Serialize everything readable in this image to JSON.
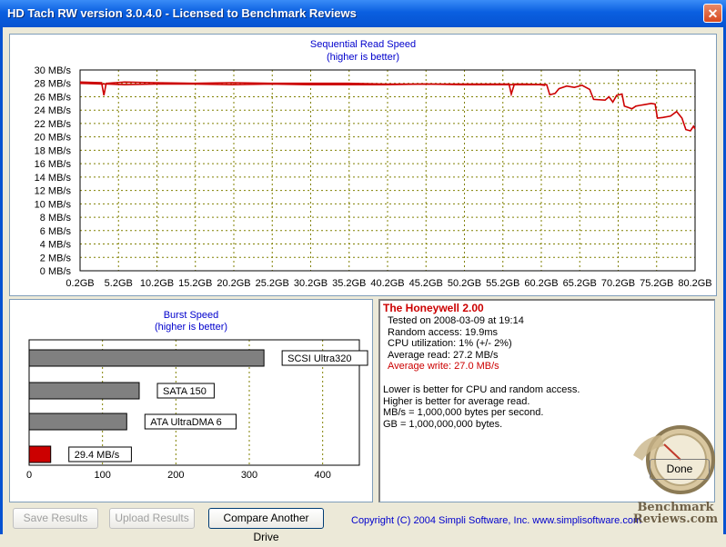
{
  "window": {
    "title": "HD Tach RW version 3.0.4.0 - Licensed to Benchmark Reviews",
    "close_label": "✕"
  },
  "sequential": {
    "title_line1": "Sequential Read Speed",
    "title_line2": "(higher is better)"
  },
  "burst": {
    "title_line1": "Burst Speed",
    "title_line2": "(higher is better)"
  },
  "info": {
    "drive_name": "The Honeywell 2.00",
    "tested_on": "Tested on 2008-03-09 at 19:14",
    "random_access": "Random access: 19.9ms",
    "cpu_util": "CPU utilization: 1% (+/- 2%)",
    "avg_read": "Average read: 27.2 MB/s",
    "avg_write": "Average write: 27.0 MB/s",
    "note1": "Lower is better for CPU and random access.",
    "note2": "Higher is better for average read.",
    "note3": "MB/s = 1,000,000 bytes per second.",
    "note4": "GB = 1,000,000,000 bytes."
  },
  "buttons": {
    "save": "Save Results",
    "upload": "Upload Results",
    "compare": "Compare Another Drive",
    "done": "Done"
  },
  "copyright": "Copyright (C) 2004 Simpli Software, Inc. www.simplisoftware.com",
  "watermark": {
    "line1": "Benchmark",
    "line2": "Reviews.com"
  },
  "colors": {
    "read_line": "#cc0000",
    "write_line": "#cc0000",
    "grid": "#808000",
    "bar_gray": "#808080",
    "bar_red": "#cc0000",
    "link_blue": "#0000cc"
  },
  "chart_data": [
    {
      "type": "line",
      "title": "Sequential Read Speed",
      "subtitle": "(higher is better)",
      "x_ticks": [
        "0.2GB",
        "5.2GB",
        "10.2GB",
        "15.2GB",
        "20.2GB",
        "25.2GB",
        "30.2GB",
        "35.2GB",
        "40.2GB",
        "45.2GB",
        "50.2GB",
        "55.2GB",
        "60.2GB",
        "65.2GB",
        "70.2GB",
        "75.2GB",
        "80.2GB"
      ],
      "y_ticks": [
        "0 MB/s",
        "2 MB/s",
        "4 MB/s",
        "6 MB/s",
        "8 MB/s",
        "10 MB/s",
        "12 MB/s",
        "14 MB/s",
        "16 MB/s",
        "18 MB/s",
        "20 MB/s",
        "22 MB/s",
        "24 MB/s",
        "26 MB/s",
        "28 MB/s",
        "30 MB/s"
      ],
      "xlim": [
        0.2,
        80.2
      ],
      "ylim": [
        0,
        30
      ],
      "grid": true,
      "series": [
        {
          "values": [
            [
              0.2,
              28.2
            ],
            [
              3.0,
              28.1
            ],
            [
              3.3,
              26.2
            ],
            [
              3.6,
              28.0
            ],
            [
              6,
              28.2
            ],
            [
              10,
              28.1
            ],
            [
              15,
              28.0
            ],
            [
              20,
              28.1
            ],
            [
              25,
              28.0
            ],
            [
              30,
              28.0
            ],
            [
              35,
              28.0
            ],
            [
              40,
              27.9
            ],
            [
              45,
              27.9
            ],
            [
              50,
              27.9
            ],
            [
              55.0,
              27.9
            ],
            [
              56.0,
              27.9
            ],
            [
              56.3,
              26.4
            ],
            [
              56.7,
              27.9
            ],
            [
              58,
              27.9
            ],
            [
              60.9,
              27.8
            ],
            [
              61.3,
              26.3
            ],
            [
              62,
              26.5
            ],
            [
              62.5,
              27.2
            ],
            [
              63.5,
              27.6
            ],
            [
              64.5,
              27.4
            ],
            [
              65.5,
              27.7
            ],
            [
              66.5,
              27.1
            ],
            [
              67,
              25.6
            ],
            [
              68.5,
              25.5
            ],
            [
              69,
              26.0
            ],
            [
              69.5,
              25.2
            ],
            [
              70,
              26.2
            ],
            [
              70.7,
              26.4
            ],
            [
              71,
              24.6
            ],
            [
              72,
              24.2
            ],
            [
              72.5,
              24.6
            ],
            [
              73,
              24.7
            ],
            [
              73.5,
              24.8
            ],
            [
              74.5,
              25.0
            ],
            [
              75,
              24.9
            ],
            [
              75.3,
              22.8
            ],
            [
              76,
              22.9
            ],
            [
              77,
              23.1
            ],
            [
              77.8,
              23.8
            ],
            [
              78.5,
              22.8
            ],
            [
              79,
              21.1
            ],
            [
              79.6,
              20.9
            ],
            [
              80,
              21.6
            ],
            [
              80.2,
              21.2
            ]
          ]
        },
        {
          "values": [
            [
              0.2,
              28.0
            ],
            [
              3.0,
              27.9
            ],
            [
              3.8,
              27.9
            ],
            [
              6,
              27.8
            ],
            [
              10,
              27.9
            ],
            [
              15,
              27.9
            ],
            [
              20,
              27.8
            ],
            [
              25,
              27.9
            ],
            [
              30,
              27.8
            ],
            [
              35,
              27.8
            ],
            [
              40,
              27.8
            ],
            [
              45,
              27.9
            ],
            [
              50,
              27.8
            ],
            [
              55,
              27.8
            ],
            [
              60,
              27.8
            ],
            [
              60.7,
              27.7
            ]
          ]
        }
      ]
    },
    {
      "type": "bar",
      "title": "Burst Speed",
      "subtitle": "(higher is better)",
      "orientation": "horizontal",
      "categories": [
        "SCSI Ultra320",
        "SATA 150",
        "ATA UltraDMA 6",
        "29.4 MB/s"
      ],
      "values": [
        320,
        150,
        133,
        29.4
      ],
      "x_ticks": [
        "0",
        "100",
        "200",
        "300",
        "400"
      ],
      "xlim": [
        0,
        450
      ],
      "grid": true
    }
  ]
}
